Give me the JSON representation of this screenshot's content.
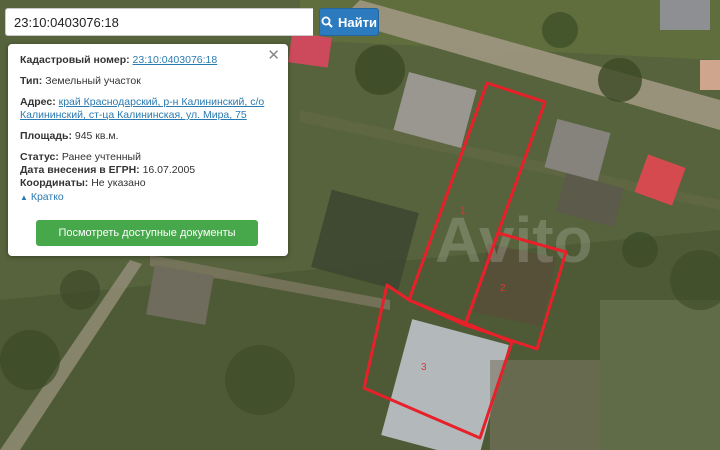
{
  "search": {
    "value": "23:10:0403076:18",
    "button_label": "Найти"
  },
  "info_card": {
    "cadastral_label": "Кадастровый номер:",
    "cadastral_value": "23:10:0403076:18",
    "type_label": "Тип:",
    "type_value": "Земельный участок",
    "address_label": "Адрес:",
    "address_line1": "край Краснодарский, р-н Калининский, с/о",
    "address_line2": "Калининский, ст-ца Калининская, ул. Мира, 75",
    "area_label": "Площадь:",
    "area_value": "945 кв.м.",
    "status_label": "Статус:",
    "status_value": "Ранее учтенный",
    "egrn_label": "Дата внесения в ЕГРН:",
    "egrn_value": "16.07.2005",
    "coords_label": "Координаты:",
    "coords_value": "Не указано",
    "toggle_label": "Кратко",
    "docs_button_label": "Посмотреть доступные документы"
  },
  "map": {
    "plots": [
      {
        "label": "1"
      },
      {
        "label": "2"
      },
      {
        "label": "3"
      }
    ],
    "watermark": "Avito",
    "colors": {
      "boundary": "#e8202a",
      "search_button": "#2d7bbf",
      "docs_button": "#46a84a",
      "link": "#2a7ab0"
    }
  }
}
